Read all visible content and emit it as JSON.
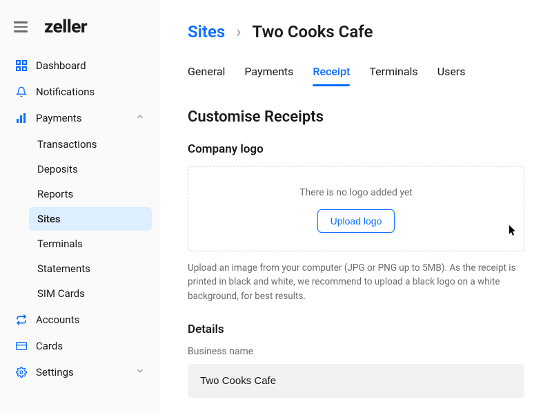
{
  "brand": "zeller",
  "sidebar": {
    "items": [
      {
        "label": "Dashboard"
      },
      {
        "label": "Notifications"
      },
      {
        "label": "Payments"
      },
      {
        "label": "Accounts"
      },
      {
        "label": "Cards"
      },
      {
        "label": "Settings"
      }
    ],
    "payments_sub": [
      {
        "label": "Transactions"
      },
      {
        "label": "Deposits"
      },
      {
        "label": "Reports"
      },
      {
        "label": "Sites"
      },
      {
        "label": "Terminals"
      },
      {
        "label": "Statements"
      },
      {
        "label": "SIM Cards"
      }
    ]
  },
  "breadcrumb": {
    "parent": "Sites",
    "current": "Two Cooks Cafe"
  },
  "tabs": [
    {
      "label": "General"
    },
    {
      "label": "Payments"
    },
    {
      "label": "Receipt"
    },
    {
      "label": "Terminals"
    },
    {
      "label": "Users"
    }
  ],
  "sections": {
    "customise_title": "Customise Receipts",
    "company_logo_title": "Company logo",
    "logo_empty_text": "There is no logo added yet",
    "upload_button": "Upload logo",
    "upload_helper": "Upload an image from your computer (JPG or PNG up to 5MB). As the receipt is printed in black and white, we recommend to upload a black logo on a white background, for best results.",
    "details_title": "Details",
    "business_name_label": "Business name",
    "business_name_value": "Two Cooks Cafe"
  }
}
